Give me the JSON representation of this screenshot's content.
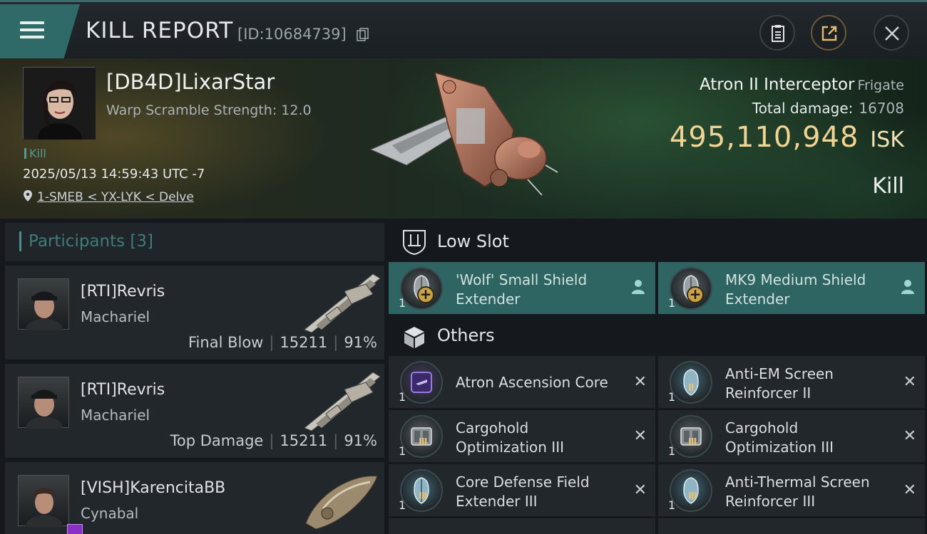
{
  "header": {
    "title": "KILL REPORT",
    "report_id": "[ID:10684739]"
  },
  "victim": {
    "name": "[DB4D]LixarStar",
    "warp_scramble": "Warp Scramble Strength: 12.0",
    "kill_tag": "Kill",
    "datetime": "2025/05/13 14:59:43 UTC -7",
    "location": "1-SMEB < YX-LYK < Delve",
    "ship_name": "Atron II Interceptor",
    "ship_class": "Frigate",
    "total_damage_label": "Total damage:",
    "total_damage": "16708",
    "isk_value": "495,110,948",
    "isk_currency": "ISK",
    "result": "Kill"
  },
  "participants": {
    "label": "Participants",
    "count": "[3]",
    "items": [
      {
        "name": "[RTI]Revris",
        "ship": "Machariel",
        "role": "Final Blow",
        "damage": "15211",
        "percent": "91%"
      },
      {
        "name": "[RTI]Revris",
        "ship": "Machariel",
        "role": "Top Damage",
        "damage": "15211",
        "percent": "91%"
      },
      {
        "name": "[VISH]KarencitaBB",
        "ship": "Cynabal"
      }
    ]
  },
  "fitting": {
    "low_slot_label": "Low Slot",
    "others_label": "Others",
    "low_slot": [
      {
        "qty": "1",
        "name_line1": "'Wolf' Small Shield",
        "name_line2": "Extender"
      },
      {
        "qty": "1",
        "name_line1": "MK9 Medium Shield",
        "name_line2": "Extender"
      }
    ],
    "others": [
      {
        "qty": "1",
        "name_line1": "Atron Ascension Core",
        "name_line2": "",
        "tier": ""
      },
      {
        "qty": "1",
        "name_line1": "Anti-EM Screen",
        "name_line2": "Reinforcer II",
        "tier": "II"
      },
      {
        "qty": "1",
        "name_line1": "Cargohold",
        "name_line2": "Optimization III",
        "tier": "III"
      },
      {
        "qty": "1",
        "name_line1": "Cargohold",
        "name_line2": "Optimization III",
        "tier": "III"
      },
      {
        "qty": "1",
        "name_line1": "Core Defense Field",
        "name_line2": "Extender III",
        "tier": "III"
      },
      {
        "qty": "1",
        "name_line1": "Anti-Thermal Screen",
        "name_line2": "Reinforcer III",
        "tier": "III"
      }
    ],
    "remove_glyph": "✕"
  },
  "colors": {
    "accent_teal": "#2e6462",
    "isk_gold": "#f1d393"
  }
}
